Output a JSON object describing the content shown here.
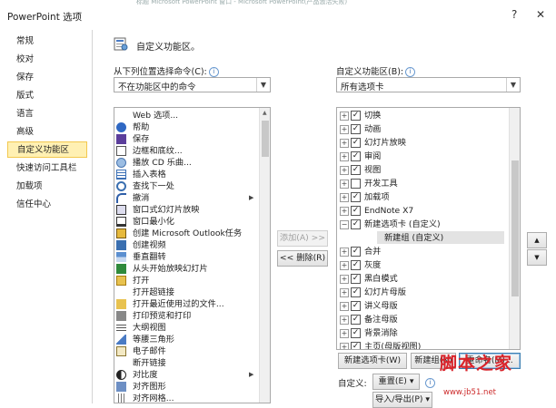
{
  "window": {
    "title": "PowerPoint 选项",
    "help": "?",
    "close": "✕",
    "top_strip": "标题 Microsoft PowerPoint 窗口 - Microsoft PowerPoint(产品激活失败)"
  },
  "nav": {
    "items": [
      {
        "label": "常规"
      },
      {
        "label": "校对"
      },
      {
        "label": "保存"
      },
      {
        "label": "版式"
      },
      {
        "label": "语言"
      },
      {
        "label": "高级"
      },
      {
        "label": "自定义功能区"
      },
      {
        "label": "快速访问工具栏"
      },
      {
        "label": "加载项"
      },
      {
        "label": "信任中心"
      }
    ],
    "selected_index": 6
  },
  "header": {
    "title": "自定义功能区。"
  },
  "left": {
    "label": "从下列位置选择命令(C):",
    "combo_value": "不在功能区中的命令",
    "commands": [
      {
        "label": "Web 选项...",
        "icon": "none"
      },
      {
        "label": "帮助",
        "icon": "help-icon"
      },
      {
        "label": "保存",
        "icon": "save-icon"
      },
      {
        "label": "边框和底纹...",
        "icon": "borders-icon"
      },
      {
        "label": "播放 CD 乐曲...",
        "icon": "cd-icon"
      },
      {
        "label": "插入表格",
        "icon": "table-icon"
      },
      {
        "label": "查找下一处",
        "icon": "find-icon"
      },
      {
        "label": "撤消",
        "icon": "undo-icon",
        "arrow": true
      },
      {
        "label": "窗口式幻灯片放映",
        "icon": "slideshow-icon"
      },
      {
        "label": "窗口最小化",
        "icon": "minimize-icon"
      },
      {
        "label": "创建 Microsoft Outlook任务",
        "icon": "outlook-task-icon"
      },
      {
        "label": "创建视频",
        "icon": "video-icon"
      },
      {
        "label": "垂直翻转",
        "icon": "flip-vertical-icon"
      },
      {
        "label": "从头开始放映幻灯片",
        "icon": "play-icon"
      },
      {
        "label": "打开",
        "icon": "open-icon"
      },
      {
        "label": "打开超链接",
        "icon": "none"
      },
      {
        "label": "打开最近使用过的文件...",
        "icon": "recent-icon"
      },
      {
        "label": "打印预览和打印",
        "icon": "print-icon"
      },
      {
        "label": "大纲视图",
        "icon": "outline-icon"
      },
      {
        "label": "等腰三角形",
        "icon": "triangle-icon"
      },
      {
        "label": "电子邮件",
        "icon": "mail-icon"
      },
      {
        "label": "断开链接",
        "icon": "none"
      },
      {
        "label": "对比度",
        "icon": "contrast-icon",
        "arrow": true
      },
      {
        "label": "对齐图形",
        "icon": "align-icon"
      },
      {
        "label": "对齐网格...",
        "icon": "grid-icon"
      }
    ]
  },
  "middle": {
    "add_label": "添加(A) >>",
    "remove_label": "<< 删除(R)"
  },
  "right": {
    "label": "自定义功能区(B):",
    "combo_value": "所有选项卡",
    "tree": [
      {
        "label": "切换",
        "checked": true,
        "level": 1,
        "expander": "+"
      },
      {
        "label": "动画",
        "checked": true,
        "level": 1,
        "expander": "+"
      },
      {
        "label": "幻灯片放映",
        "checked": true,
        "level": 1,
        "expander": "+"
      },
      {
        "label": "审阅",
        "checked": true,
        "level": 1,
        "expander": "+"
      },
      {
        "label": "视图",
        "checked": true,
        "level": 1,
        "expander": "+"
      },
      {
        "label": "开发工具",
        "checked": false,
        "level": 1,
        "expander": "+"
      },
      {
        "label": "加载项",
        "checked": true,
        "level": 1,
        "expander": "+"
      },
      {
        "label": "EndNote X7",
        "checked": true,
        "level": 1,
        "expander": "+"
      },
      {
        "label": "新建选项卡 (自定义)",
        "checked": true,
        "level": 1,
        "expander": "−"
      },
      {
        "label": "新建组 (自定义)",
        "checked": null,
        "level": 2,
        "expander": "",
        "selected": true
      },
      {
        "label": "合并",
        "checked": true,
        "level": 1,
        "expander": "+"
      },
      {
        "label": "灰度",
        "checked": true,
        "level": 1,
        "expander": "+"
      },
      {
        "label": "黑白模式",
        "checked": true,
        "level": 1,
        "expander": "+"
      },
      {
        "label": "幻灯片母版",
        "checked": true,
        "level": 1,
        "expander": "+"
      },
      {
        "label": "讲义母版",
        "checked": true,
        "level": 1,
        "expander": "+"
      },
      {
        "label": "备注母版",
        "checked": true,
        "level": 1,
        "expander": "+"
      },
      {
        "label": "背景消除",
        "checked": true,
        "level": 1,
        "expander": "+"
      },
      {
        "label": "主页(母版视图)",
        "checked": true,
        "level": 1,
        "expander": "+"
      }
    ],
    "new_tab_label": "新建选项卡(W)",
    "new_group_label": "新建组(N)",
    "rename_label": "重命名(M)...",
    "customize_label": "自定义:",
    "reset_label": "重置(E) ▾",
    "import_export_label": "导入/导出(P) ▾"
  },
  "move": {
    "up": "▲",
    "down": "▼"
  },
  "watermark": {
    "logo": "脚本之家",
    "url": "www.jb51.net"
  }
}
